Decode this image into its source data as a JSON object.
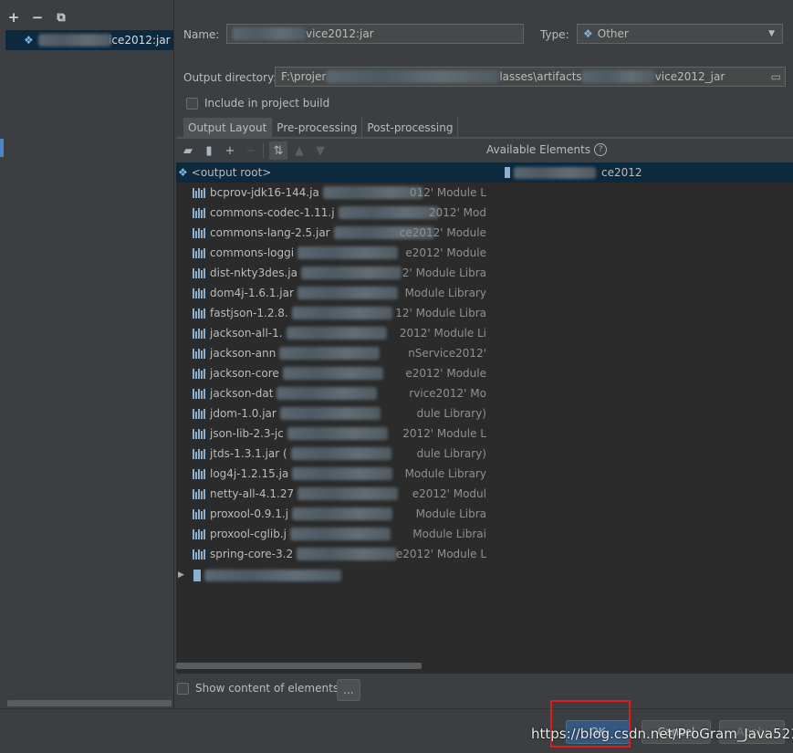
{
  "left_panel": {
    "toolbar": {
      "add": "+",
      "remove": "−",
      "copy": "⧉"
    },
    "artifact_name": "vice2012:jar"
  },
  "form": {
    "name_label": "Name:",
    "name_value": "vice2012:jar",
    "type_label": "Type:",
    "type_value": "Other",
    "outdir_label": "Output directory:",
    "outdir_value_start": "F:\\projer",
    "outdir_value_mid": "lasses\\artifacts",
    "outdir_value_end": "vice2012_jar",
    "include_build_label": "Include in project build"
  },
  "tabs": [
    {
      "label": "Output Layout"
    },
    {
      "label": "Pre-processing"
    },
    {
      "label": "Post-processing"
    }
  ],
  "available_elements": {
    "label": "Available Elements",
    "help": "?",
    "item_tail": "ce2012"
  },
  "tree": {
    "root_label": "<output root>",
    "rows": [
      {
        "name": "bcprov-jdk16-144.ja",
        "tail": "012' Module L"
      },
      {
        "name": "commons-codec-1.11.j",
        "tail": "2012' Mod"
      },
      {
        "name": "commons-lang-2.5.jar",
        "tail": "ce2012' Module"
      },
      {
        "name": "commons-loggi",
        "tail": "e2012' Module"
      },
      {
        "name": "dist-nkty3des.ja",
        "tail": "2' Module Libra"
      },
      {
        "name": "dom4j-1.6.1.jar",
        "tail": "Module Library"
      },
      {
        "name": "fastjson-1.2.8.",
        "tail": "12' Module Libra"
      },
      {
        "name": "jackson-all-1.",
        "tail": "2012' Module Li"
      },
      {
        "name": "jackson-ann",
        "tail": "nService2012'"
      },
      {
        "name": "jackson-core",
        "tail": "e2012' Module"
      },
      {
        "name": "jackson-dat",
        "tail": "rvice2012' Mo"
      },
      {
        "name": "jdom-1.0.jar",
        "tail": "dule Library)"
      },
      {
        "name": "json-lib-2.3-jc",
        "tail": "2012' Module L"
      },
      {
        "name": "jtds-1.3.1.jar (",
        "tail": "dule Library)"
      },
      {
        "name": "log4j-1.2.15.ja",
        "tail": "Module Library"
      },
      {
        "name": "netty-all-4.1.27",
        "tail": "e2012' Modul"
      },
      {
        "name": "proxool-0.9.1.j",
        "tail": "Module Libra"
      },
      {
        "name": "proxool-cglib.j",
        "tail": "Module Librai"
      },
      {
        "name": "spring-core-3.2",
        "tail": "e2012' Module L"
      }
    ]
  },
  "bottom": {
    "show_content_label": "Show content of elements",
    "dots": "..."
  },
  "footer": {
    "ok": "OK",
    "cancel": "Cancel",
    "apply": "Apply",
    "watermark": "https://blog.csdn.net/ProGram_Java521"
  },
  "colors": {
    "selection": "#0d293e",
    "highlight_box": "#e01c1c",
    "ok_button": "#365880"
  }
}
